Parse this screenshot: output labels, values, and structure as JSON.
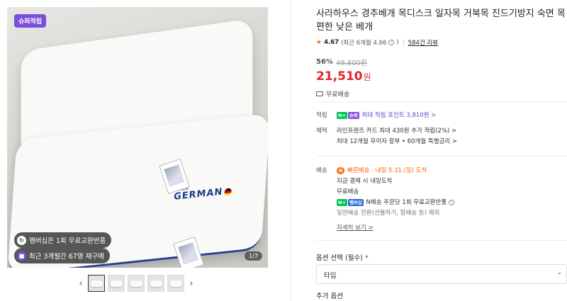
{
  "gallery": {
    "badge": "슈퍼적립",
    "pill_membership": "멤버십은 1회 무료교환반품",
    "pill_recent": "최근 3개월간 67명 재구매",
    "pager": "1/7",
    "prev_icon": "chevron-left-icon",
    "next_icon": "chevron-right-icon",
    "brand_small": "outlast",
    "brand": "GERMAN"
  },
  "product": {
    "title": "사라하우스 경추베개 목디스크 일자목 거북목 진드기방지 숙면 목편한 낮은 베개",
    "rating_score": "4.67",
    "rating_recent": "(최근 6개월 4.66",
    "rating_recent_close": ")",
    "review_count": "584건 리뷰",
    "discount": "56%",
    "original_price": "49,800원",
    "price": "21,510",
    "currency": "원",
    "shipping_free": "무료배송"
  },
  "benefits": {
    "points_label": "적립",
    "points_chip_n": "N+",
    "points_chip_super": "슈퍼",
    "points_text": "최대 적립 포인트 3,810원 >",
    "perk_label": "혜택",
    "perk_line1": "라인프렌즈 카드 최대 430원 추가 적립(2%) >",
    "perk_line2": "최대 12개월 무이자 할부 • 60개월 특별금리 >"
  },
  "delivery": {
    "label": "배송",
    "fast_chip": "N",
    "fast_text": "빠른배송 · 내일 5.31.(일) 도착",
    "line2": "지금 결제 시 내일도착",
    "line3": "무료배송",
    "chip_n": "N+",
    "chip_membership": "멤버십",
    "line4": "N배송 주문당 1회 무료교환반품",
    "line5": "일반배송 전환(선물하기, 합배송 등) 제외",
    "more": "자세히 보기 >"
  },
  "options": {
    "label": "옵션 선택 (필수)",
    "required_mark": "*",
    "select_value": "타입",
    "extra_label": "추가 옵션"
  },
  "colors": {
    "price": "#e0252a",
    "badge": "#7b4ddb",
    "naver_green": "#03c75a",
    "link_purple": "#6f3fd3"
  }
}
